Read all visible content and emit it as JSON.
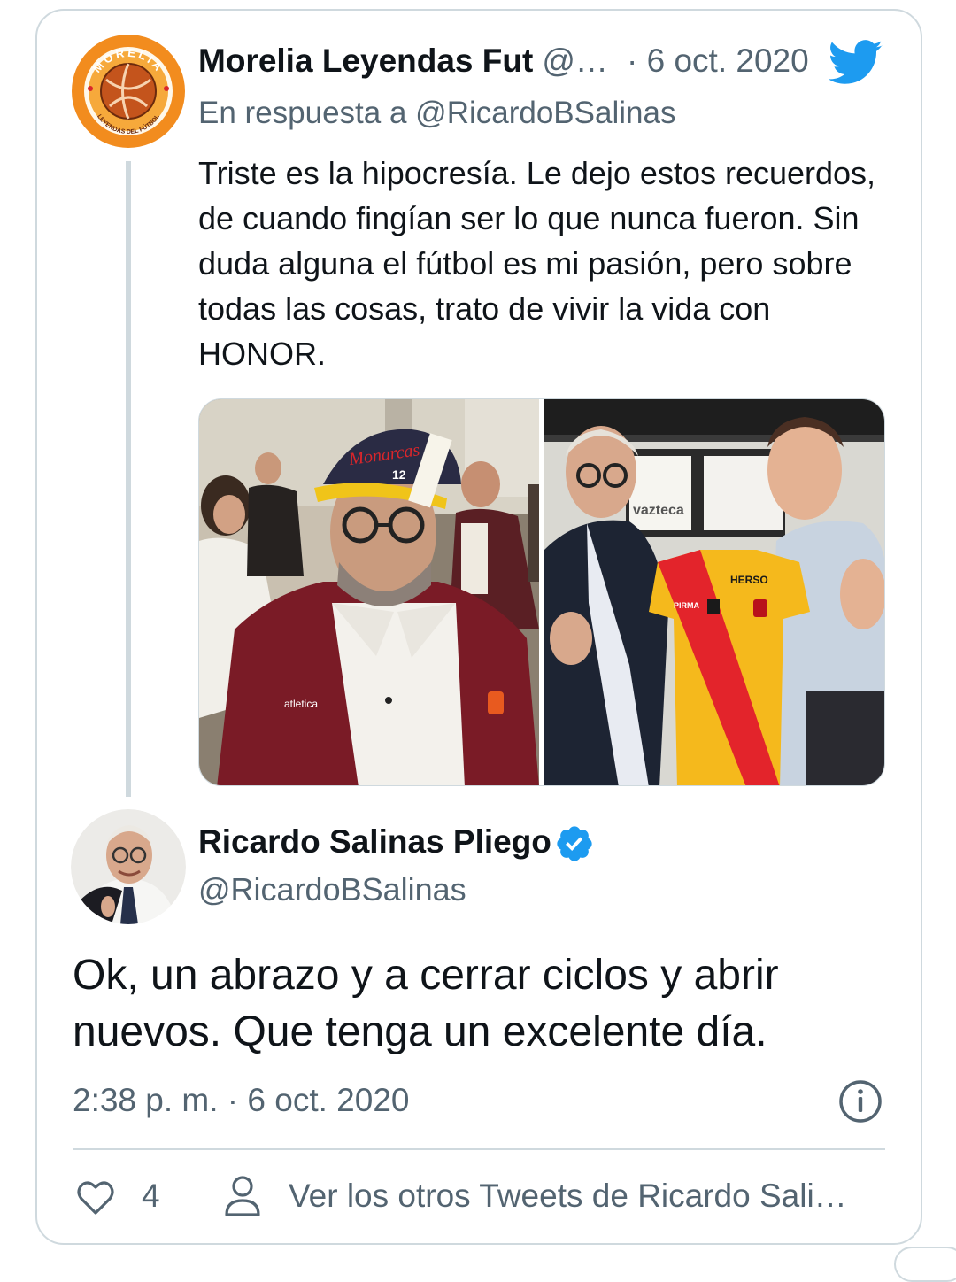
{
  "parent_tweet": {
    "author_name": "Morelia Leyendas Fut",
    "author_handle": "@…",
    "date": "· 6 oct. 2020",
    "reply_prefix": "En respuesta a",
    "reply_mention": "@RicardoBSalinas",
    "text": "Triste es la hipocresía. Le dejo estos recuerdos, de cuando fingían ser lo que nunca fueron. Sin duda alguna el fútbol es mi pasión, pero sobre todas las cosas, trato de vivir la vida con HONOR.",
    "avatar_ring_top": "MORELIA",
    "avatar_ring_bottom": "LEYENDAS DEL FÚTBOL",
    "photo_left_cap": "Monarcas",
    "photo_left_cap_number": "12",
    "photo_left_jacket_brand": "atletica",
    "photo_right_tv_logo": "vazteca",
    "photo_right_shirt_sponsor": "HERSO",
    "photo_right_shirt_brand": "PIRMA"
  },
  "main_tweet": {
    "author_name": "Ricardo Salinas Pliego",
    "author_handle": "@RicardoBSalinas",
    "text": "Ok, un abrazo y a cerrar ciclos y abrir nuevos. Que tenga un excelente día.",
    "timestamp": "2:38 p. m. · 6 oct. 2020",
    "likes": "4",
    "more_tweets_label": "Ver los otros Tweets de Ricardo Sali…"
  },
  "icons": {
    "brand": "twitter-bird-icon",
    "verified": "verified-badge-icon",
    "info": "info-icon",
    "like": "heart-icon",
    "profile": "person-icon"
  },
  "colors": {
    "twitter_blue": "#1d9bf0",
    "secondary_text": "#536471",
    "border": "#cfd9de",
    "morelia_orange": "#f28c1e",
    "morelia_red": "#d9262b"
  }
}
